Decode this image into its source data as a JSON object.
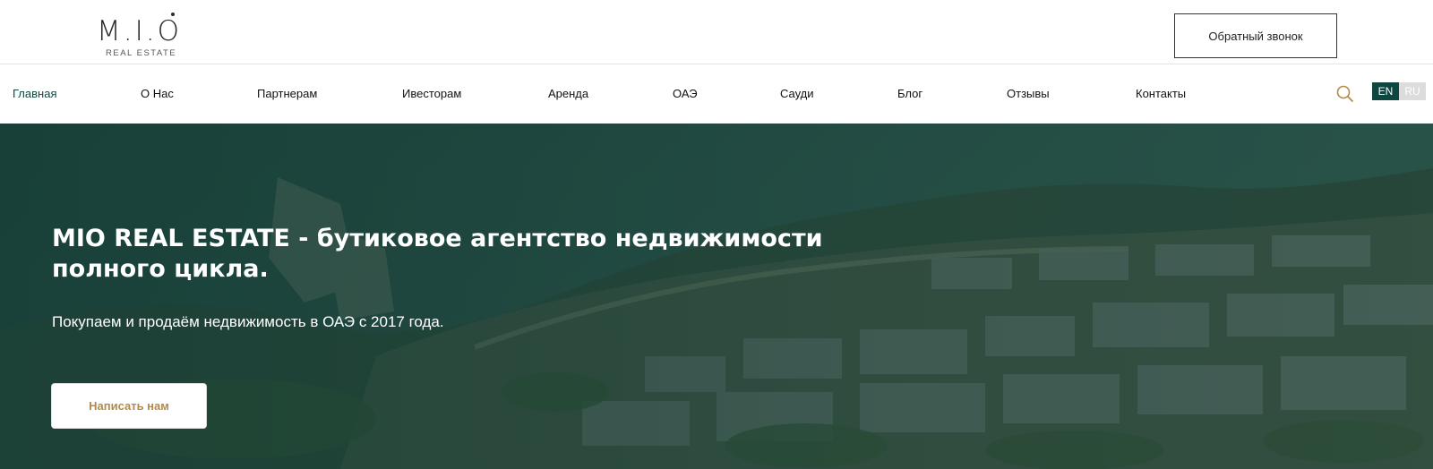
{
  "header": {
    "logo_mark": "M.I.O",
    "logo_sub": "REAL ESTATE",
    "callback_label": "Обратный звонок"
  },
  "nav": {
    "items": [
      {
        "label": "Главная",
        "active": true
      },
      {
        "label": "О Нас"
      },
      {
        "label": "Партнерам"
      },
      {
        "label": "Ивесторам"
      },
      {
        "label": "Аренда"
      },
      {
        "label": "ОАЭ"
      },
      {
        "label": "Сауди"
      },
      {
        "label": "Блог"
      },
      {
        "label": "Отзывы"
      },
      {
        "label": "Контакты"
      }
    ],
    "lang_en": "EN",
    "lang_ru": "RU",
    "search_icon": "search-icon"
  },
  "hero": {
    "title_line1": "MIO REAL ESTATE - бутиковое агентство недвижимости",
    "title_line2": "полного цикла.",
    "subtitle": "Покупаем и продаём недвижимость в ОАЭ с 2017 года.",
    "cta_label": "Написать нам"
  },
  "colors": {
    "accent": "#0e4640",
    "gold": "#b38a4a",
    "overlay": "#163c35"
  }
}
